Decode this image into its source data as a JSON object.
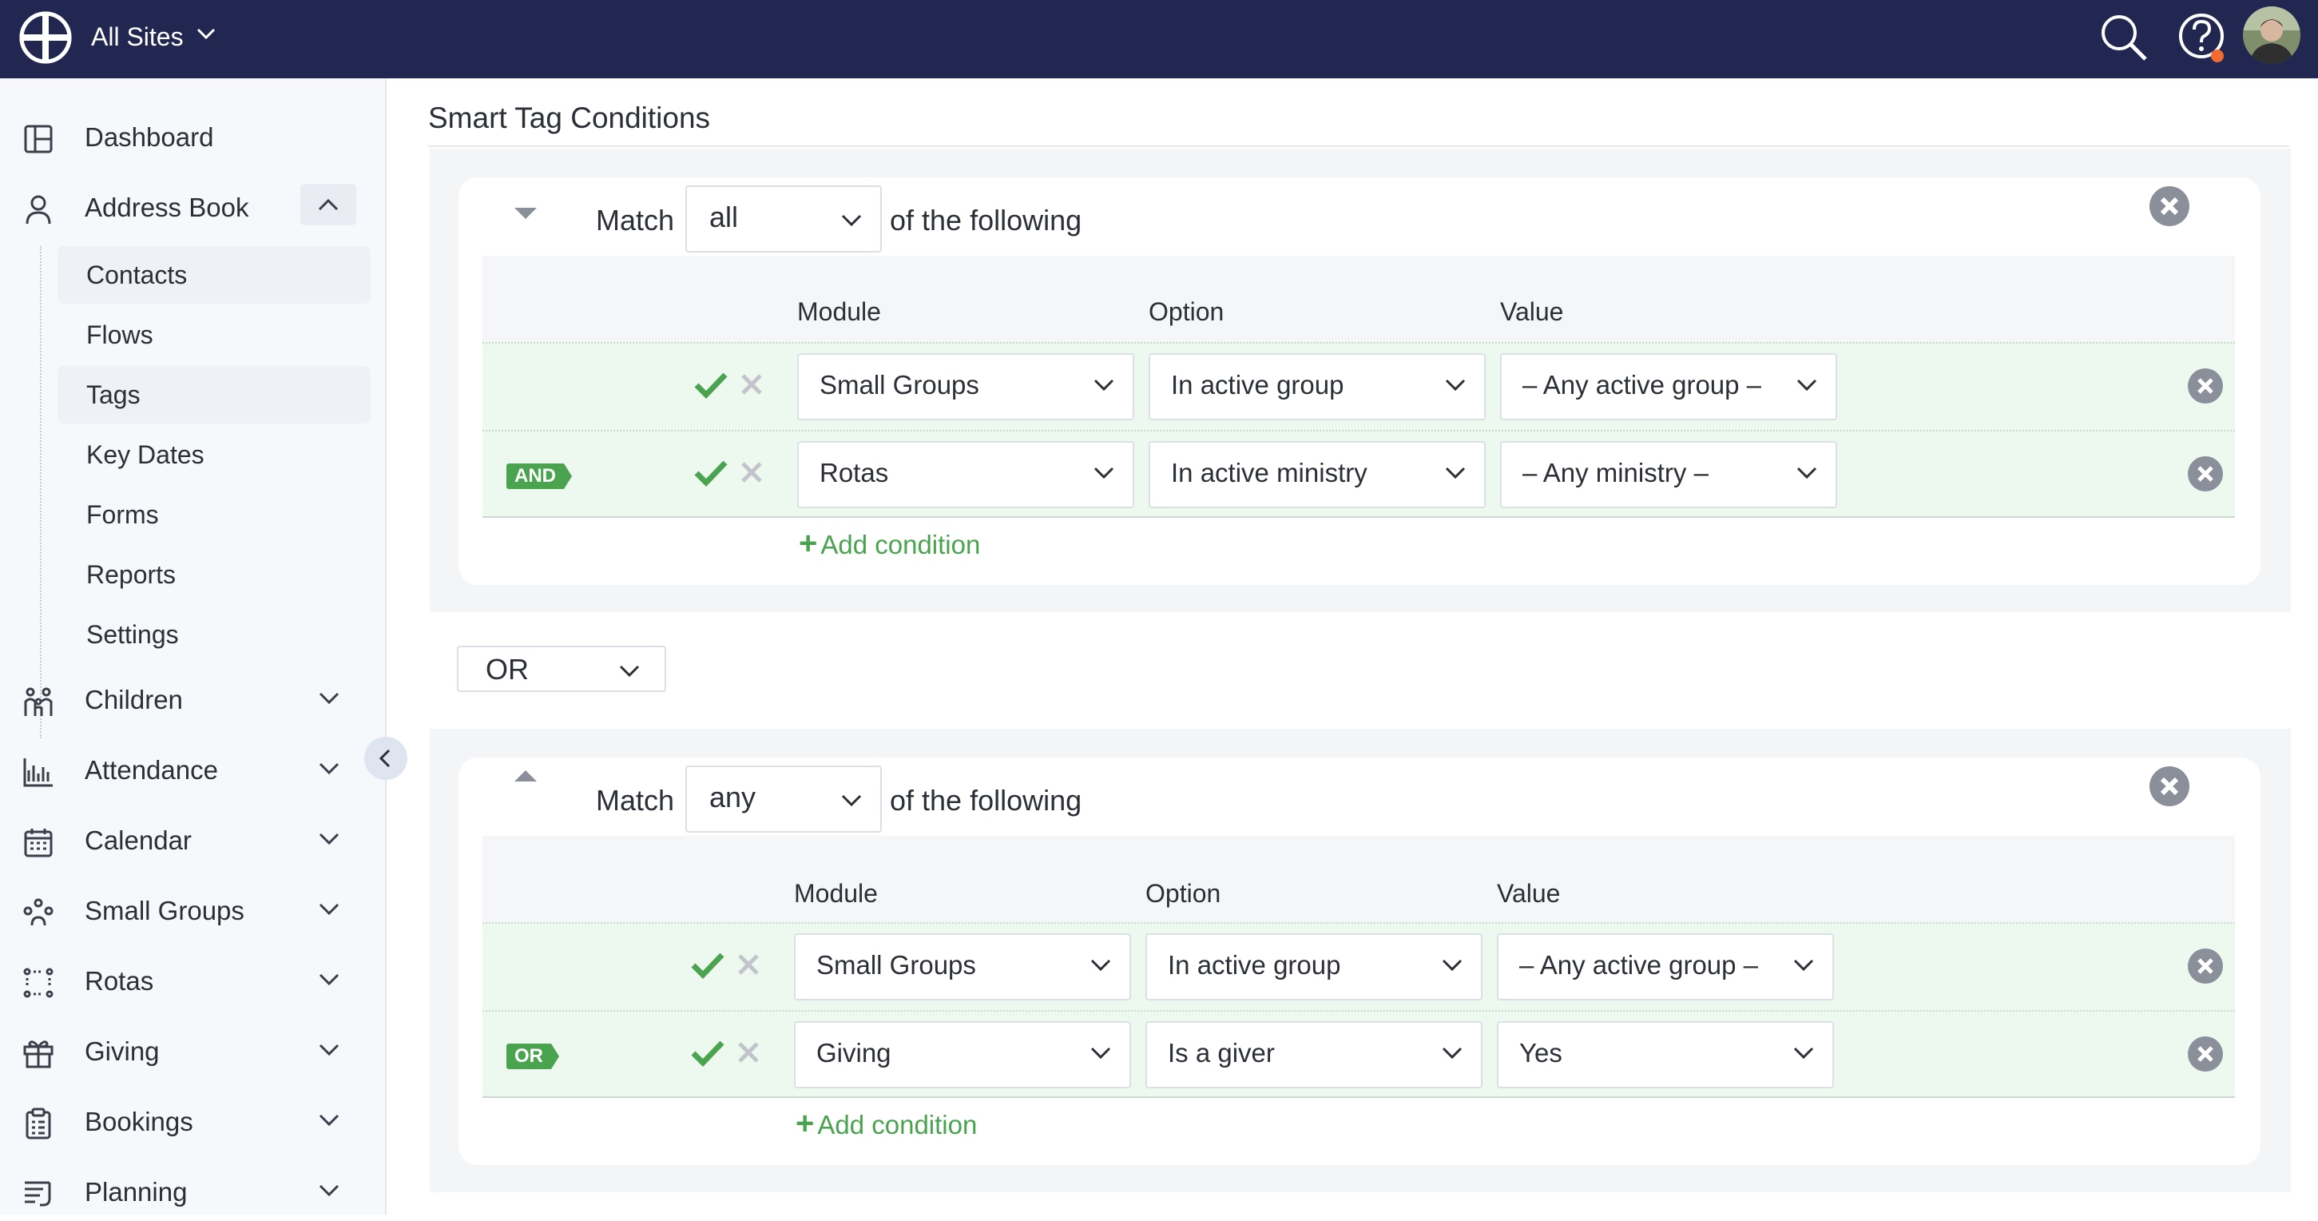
{
  "topbar": {
    "site_name": "All Sites"
  },
  "sidebar": {
    "items": [
      {
        "label": "Dashboard",
        "icon": "dashboard-icon"
      },
      {
        "label": "Address Book",
        "icon": "person-icon"
      },
      {
        "label": "Children",
        "icon": "children-icon"
      },
      {
        "label": "Attendance",
        "icon": "chart-icon"
      },
      {
        "label": "Calendar",
        "icon": "calendar-icon"
      },
      {
        "label": "Small Groups",
        "icon": "groups-icon"
      },
      {
        "label": "Rotas",
        "icon": "rotas-icon"
      },
      {
        "label": "Giving",
        "icon": "gift-icon"
      },
      {
        "label": "Bookings",
        "icon": "clipboard-icon"
      },
      {
        "label": "Planning",
        "icon": "planning-icon"
      }
    ],
    "sub_items": [
      "Contacts",
      "Flows",
      "Tags",
      "Key Dates",
      "Forms",
      "Reports",
      "Settings"
    ]
  },
  "main": {
    "title": "Smart Tag Conditions",
    "connector": "OR",
    "groups": [
      {
        "match_label": "Match",
        "match_value": "all",
        "suffix": "of the following",
        "headers": [
          "Module",
          "Option",
          "Value"
        ],
        "add_condition": "Add condition",
        "rows": [
          {
            "badge": "",
            "module": "Small Groups",
            "option": "In active group",
            "value": "– Any active group –"
          },
          {
            "badge": "AND",
            "module": "Rotas",
            "option": "In active ministry",
            "value": "– Any ministry –"
          }
        ]
      },
      {
        "match_label": "Match",
        "match_value": "any",
        "suffix": "of the following",
        "headers": [
          "Module",
          "Option",
          "Value"
        ],
        "add_condition": "Add condition",
        "rows": [
          {
            "badge": "",
            "module": "Small Groups",
            "option": "In active group",
            "value": "– Any active group –"
          },
          {
            "badge": "OR",
            "module": "Giving",
            "option": "Is a giver",
            "value": "Yes"
          }
        ]
      }
    ]
  },
  "colors": {
    "topbar": "#222752",
    "accent_green": "#4aa34f",
    "row_bg": "#edf8ee",
    "sidebar_bg": "#f6f8fc"
  }
}
